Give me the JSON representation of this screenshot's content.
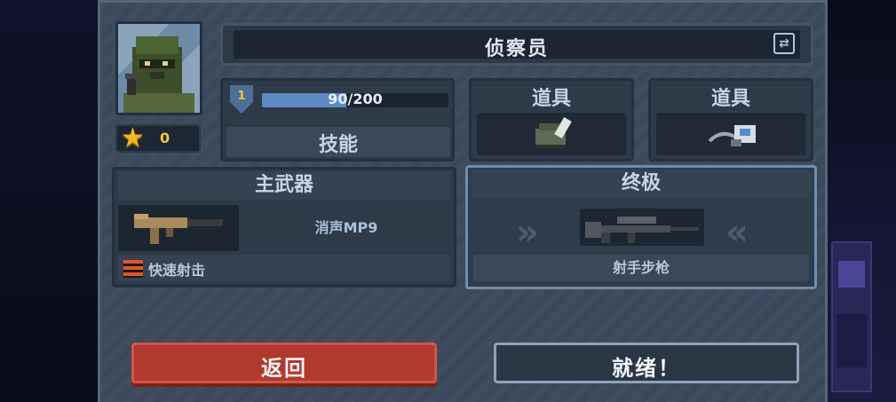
{
  "character": {
    "name": "侦察员",
    "stars": "0"
  },
  "level": {
    "number": "1",
    "xp_text": "90/200",
    "xp_progress": 0.45,
    "skill_label": "技能"
  },
  "items": [
    {
      "label": "道具",
      "icon": "grenade-icon"
    },
    {
      "label": "道具",
      "icon": "sensor-icon"
    }
  ],
  "primary_weapon": {
    "title": "主武器",
    "name": "消声MP9",
    "perk": "快速射击",
    "icon": "smg-icon"
  },
  "ultimate": {
    "title": "终极",
    "name": "射手步枪",
    "icon": "sniper-rifle-icon"
  },
  "buttons": {
    "back": "返回",
    "ready": "就绪！"
  },
  "colors": {
    "panel": "#3c4a5b",
    "back_button": "#b03a2e",
    "accent_gold": "#f0c93a",
    "xp_fill": "#5c8bc4"
  }
}
